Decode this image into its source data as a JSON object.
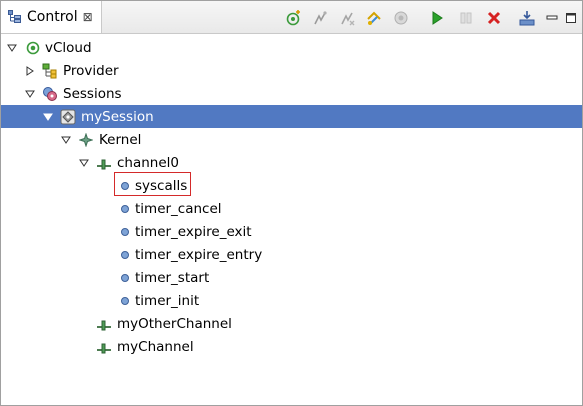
{
  "view": {
    "tab_title": "Control",
    "tab_close_glyph": "⊠",
    "icons": {
      "tab": "control-view-icon",
      "toolbar": [
        "connect-icon",
        "enable-event-icon",
        "disable-event-icon",
        "import-icon",
        "record-snapshot-icon",
        "start-tracing-icon",
        "stop-tracing-icon",
        "destroy-session-icon",
        "import-trace-icon",
        "minimize-icon",
        "maximize-icon"
      ]
    }
  },
  "tree": {
    "root": "vCloud",
    "provider": "Provider",
    "sessions": "Sessions",
    "session": "mySession",
    "kernel": "Kernel",
    "channel0": "channel0",
    "events": [
      "syscalls",
      "timer_cancel",
      "timer_expire_exit",
      "timer_expire_entry",
      "timer_start",
      "timer_init"
    ],
    "other_channels": [
      "myOtherChannel",
      "myChannel"
    ]
  },
  "colors": {
    "selection": "#5179c2",
    "focus_box": "#d42a2a",
    "start": "#2aa12a",
    "stop": "#d62222"
  }
}
